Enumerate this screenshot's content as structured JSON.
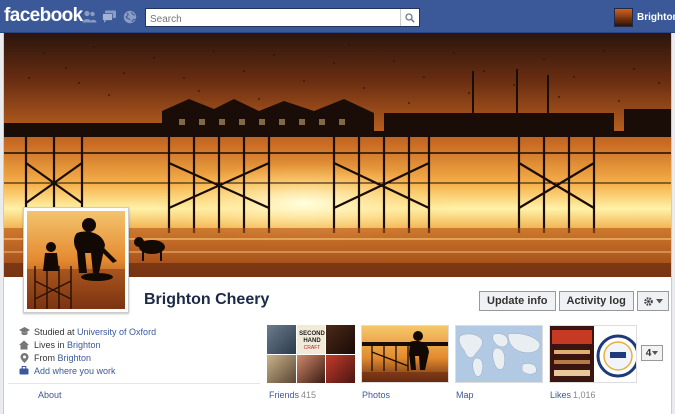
{
  "topbar": {
    "logo": "facebook",
    "search_placeholder": "Search",
    "user_name": "Brighton"
  },
  "profile": {
    "name": "Brighton Cheery",
    "actions": {
      "update_info": "Update info",
      "activity_log": "Activity log"
    }
  },
  "about": {
    "studied_prefix": "Studied at ",
    "studied_school": "University of Oxford",
    "lives_prefix": "Lives in ",
    "lives_city": "Brighton",
    "from_prefix": "From ",
    "from_city": "Brighton",
    "add_work": "Add where you work"
  },
  "tabs": {
    "about": "About",
    "friends": "Friends",
    "friends_count": "415",
    "photos": "Photos",
    "map": "Map",
    "likes": "Likes",
    "likes_count": "1,016",
    "more_count": "4"
  },
  "icons": {
    "friends": "friends-icon",
    "messages": "messages-icon",
    "notifications": "globe-icon",
    "search": "magnifier-icon",
    "settings": "gear-icon"
  },
  "colors": {
    "brand_blue": "#3b5998",
    "link": "#3b5998",
    "name_text": "#1c2a47"
  }
}
